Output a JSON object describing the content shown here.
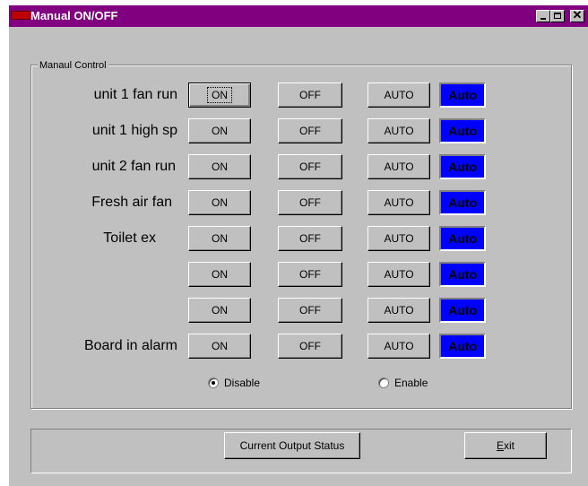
{
  "window": {
    "title": "Manual ON/OFF"
  },
  "group": {
    "label": "Manaul Control"
  },
  "rows": [
    {
      "label": "unit 1 fan run",
      "on": "ON",
      "off": "OFF",
      "auto": "AUTO",
      "indicator": "Auto"
    },
    {
      "label": "unit 1 high sp",
      "on": "ON",
      "off": "OFF",
      "auto": "AUTO",
      "indicator": "Auto"
    },
    {
      "label": "unit 2 fan run",
      "on": "ON",
      "off": "OFF",
      "auto": "AUTO",
      "indicator": "Auto"
    },
    {
      "label": "Fresh air fan",
      "on": "ON",
      "off": "OFF",
      "auto": "AUTO",
      "indicator": "Auto"
    },
    {
      "label": "Toilet ex",
      "on": "ON",
      "off": "OFF",
      "auto": "AUTO",
      "indicator": "Auto"
    },
    {
      "label": "",
      "on": "ON",
      "off": "OFF",
      "auto": "AUTO",
      "indicator": "Auto"
    },
    {
      "label": "",
      "on": "ON",
      "off": "OFF",
      "auto": "AUTO",
      "indicator": "Auto"
    },
    {
      "label": "Board in alarm",
      "on": "ON",
      "off": "OFF",
      "auto": "AUTO",
      "indicator": "Auto"
    }
  ],
  "radios": {
    "disable": {
      "label": "Disable",
      "checked": true
    },
    "enable": {
      "label": "Enable",
      "checked": false
    }
  },
  "footer": {
    "status_button": "Current Output Status",
    "exit_mnemonic": "E",
    "exit_rest": "xit"
  },
  "colors": {
    "title_bar": "#800080",
    "auto_indicator": "#0000ff",
    "face": "#c0c0c0"
  }
}
